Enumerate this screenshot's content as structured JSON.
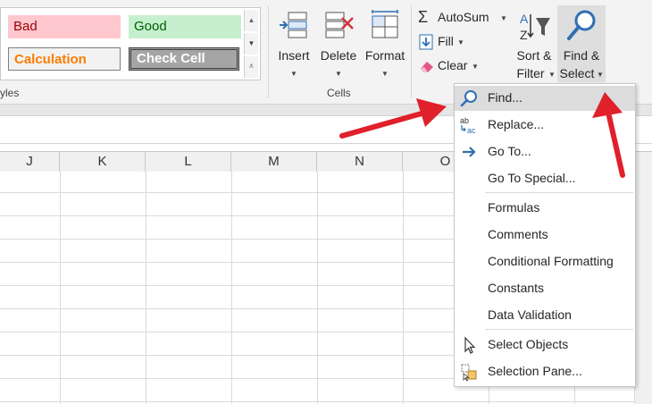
{
  "styles": {
    "bad": "Bad",
    "good": "Good",
    "calculation": "Calculation",
    "check_cell": "Check Cell",
    "group_label": "yles"
  },
  "cells": {
    "insert": "Insert",
    "delete": "Delete",
    "format": "Format",
    "group_label": "Cells"
  },
  "editing": {
    "autosum": "AutoSum",
    "fill": "Fill",
    "clear": "Clear",
    "sort_filter_line1": "Sort &",
    "sort_filter_line2": "Filter",
    "find_select_line1": "Find &",
    "find_select_line2": "Select"
  },
  "columns": [
    "J",
    "K",
    "L",
    "M",
    "N",
    "O"
  ],
  "menu": {
    "items": [
      {
        "label": "Find...",
        "icon": "magnifier-icon"
      },
      {
        "label": "Replace...",
        "icon": "replace-icon"
      },
      {
        "label": "Go To...",
        "icon": "arrow-right-icon"
      },
      {
        "label": "Go To Special...",
        "icon": ""
      },
      {
        "label": "Formulas",
        "icon": ""
      },
      {
        "label": "Comments",
        "icon": ""
      },
      {
        "label": "Conditional Formatting",
        "icon": ""
      },
      {
        "label": "Constants",
        "icon": ""
      },
      {
        "label": "Data Validation",
        "icon": ""
      },
      {
        "label": "Select Objects",
        "icon": "cursor-icon"
      },
      {
        "label": "Selection Pane...",
        "icon": "selection-pane-icon"
      }
    ]
  },
  "colors": {
    "bad_fill": "#ffc7ce",
    "bad_text": "#9c0006",
    "good_fill": "#c6efce",
    "good_text": "#006100",
    "calc_text": "#fa7d00",
    "check_fill": "#a5a5a5",
    "icon_blue": "#2f6fb3",
    "annotation_arrow": "#e0202a",
    "hover": "#dcdcdc"
  }
}
